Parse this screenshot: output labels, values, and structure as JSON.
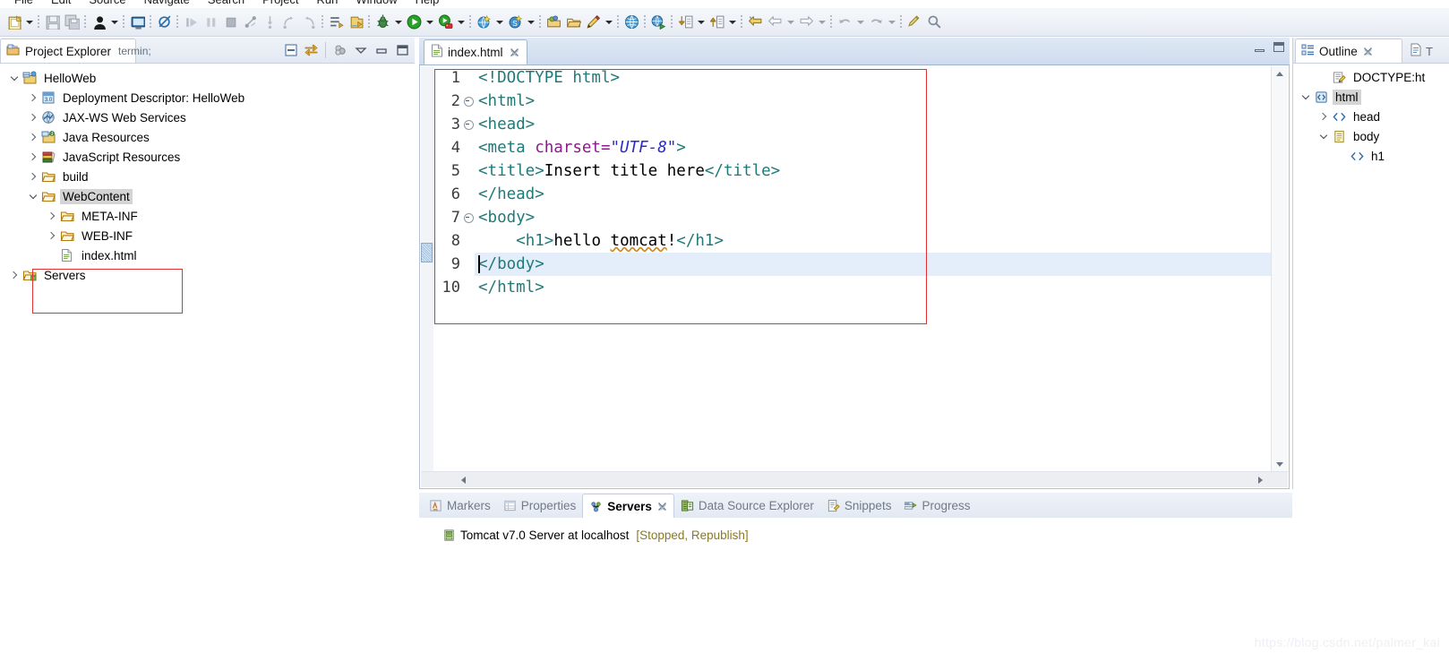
{
  "menubar": {
    "items": [
      "File",
      "Edit",
      "Source",
      "Navigate",
      "Search",
      "Project",
      "Run",
      "Window",
      "Help"
    ]
  },
  "toolbar": {
    "groups": [
      {
        "buttons": [
          {
            "name": "new-wizard-icon",
            "glyph": "new"
          },
          {
            "name": "new-wizard-dropdown-arrow",
            "glyph": "arrow"
          }
        ]
      },
      {
        "buttons": [
          {
            "name": "save-icon",
            "glyph": "save"
          },
          {
            "name": "save-all-icon",
            "glyph": "saveall"
          }
        ]
      },
      {
        "buttons": [
          {
            "name": "user-icon",
            "glyph": "person"
          },
          {
            "name": "user-dropdown-arrow",
            "glyph": "arrow"
          }
        ]
      },
      {
        "buttons": [
          {
            "name": "console-icon",
            "glyph": "console"
          }
        ]
      },
      {
        "buttons": [
          {
            "name": "skip-breakpoints-icon",
            "glyph": "nobreak"
          }
        ]
      },
      {
        "buttons": [
          {
            "name": "resume-icon",
            "glyph": "resume"
          },
          {
            "name": "suspend-icon",
            "glyph": "suspend"
          },
          {
            "name": "terminate-icon",
            "glyph": "terminate"
          },
          {
            "name": "disconnect-icon",
            "glyph": "disconnect"
          },
          {
            "name": "step-into-icon",
            "glyph": "stepinto"
          },
          {
            "name": "step-over-icon",
            "glyph": "stepover"
          },
          {
            "name": "step-return-icon",
            "glyph": "stepreturn"
          }
        ]
      },
      {
        "buttons": [
          {
            "name": "open-type-icon",
            "glyph": "opentype"
          },
          {
            "name": "open-task-icon",
            "glyph": "opentask"
          }
        ]
      },
      {
        "buttons": [
          {
            "name": "debug-icon",
            "glyph": "bug"
          },
          {
            "name": "debug-dropdown-arrow",
            "glyph": "arrow"
          },
          {
            "name": "run-icon",
            "glyph": "play"
          },
          {
            "name": "run-dropdown-arrow",
            "glyph": "arrow"
          },
          {
            "name": "run-on-server-icon",
            "glyph": "runserver"
          },
          {
            "name": "run-on-server-dropdown-arrow",
            "glyph": "arrow"
          }
        ]
      },
      {
        "buttons": [
          {
            "name": "new-web-project-icon",
            "glyph": "webnew"
          },
          {
            "name": "new-web-project-dropdown-arrow",
            "glyph": "arrow"
          },
          {
            "name": "new-server-icon",
            "glyph": "servernew"
          },
          {
            "name": "new-server-dropdown-arrow",
            "glyph": "arrow"
          }
        ]
      },
      {
        "buttons": [
          {
            "name": "open-package-icon",
            "glyph": "pkgopen"
          },
          {
            "name": "open-folder-icon",
            "glyph": "folderopen"
          },
          {
            "name": "edit-icon",
            "glyph": "pencil"
          },
          {
            "name": "edit-dropdown-arrow",
            "glyph": "arrow"
          }
        ]
      },
      {
        "buttons": [
          {
            "name": "open-browser-icon",
            "glyph": "globe"
          }
        ]
      },
      {
        "buttons": [
          {
            "name": "publish-run-icon",
            "glyph": "publishrun"
          }
        ]
      },
      {
        "buttons": [
          {
            "name": "import-icon",
            "glyph": "import"
          },
          {
            "name": "import-dropdown-arrow",
            "glyph": "arrow"
          },
          {
            "name": "export-icon",
            "glyph": "export"
          },
          {
            "name": "export-dropdown-arrow",
            "glyph": "arrow"
          }
        ]
      },
      {
        "buttons": [
          {
            "name": "annotation-next-icon",
            "glyph": "annot"
          },
          {
            "name": "back-icon",
            "glyph": "back"
          },
          {
            "name": "back-dropdown-arrow",
            "glyph": "arrowdim"
          },
          {
            "name": "forward-icon",
            "glyph": "forward"
          },
          {
            "name": "forward-dropdown-arrow",
            "glyph": "arrowdim"
          }
        ]
      },
      {
        "buttons": [
          {
            "name": "undo-icon",
            "glyph": "undo"
          },
          {
            "name": "undo-dropdown-arrow",
            "glyph": "arrowdim"
          },
          {
            "name": "redo-icon",
            "glyph": "redo"
          },
          {
            "name": "redo-dropdown-arrow",
            "glyph": "arrowdim"
          }
        ]
      },
      {
        "buttons": [
          {
            "name": "last-edit-location-icon",
            "glyph": "lastedit"
          },
          {
            "name": "search-icon",
            "glyph": "search"
          }
        ]
      }
    ]
  },
  "project_explorer": {
    "tab_label": "Project Explorer",
    "close_icon": "close-icon",
    "toolbar": [
      {
        "name": "collapse-all-icon"
      },
      {
        "name": "link-with-editor-icon"
      },
      {
        "name": "view-filter-icon"
      },
      {
        "name": "view-menu-icon"
      },
      {
        "name": "minimize-icon"
      },
      {
        "name": "maximize-icon"
      }
    ],
    "tree": [
      {
        "label": "HelloWeb",
        "indent": 0,
        "twist": "expanded",
        "icon": "web-project-icon",
        "selected": false
      },
      {
        "label": "Deployment Descriptor: HelloWeb",
        "indent": 1,
        "twist": "collapsed",
        "icon": "deployment-descriptor-icon",
        "selected": false
      },
      {
        "label": "JAX-WS Web Services",
        "indent": 1,
        "twist": "collapsed",
        "icon": "jaxws-icon",
        "selected": false
      },
      {
        "label": "Java Resources",
        "indent": 1,
        "twist": "collapsed",
        "icon": "java-resources-icon",
        "selected": false
      },
      {
        "label": "JavaScript Resources",
        "indent": 1,
        "twist": "collapsed",
        "icon": "javascript-resources-icon",
        "selected": false
      },
      {
        "label": "build",
        "indent": 1,
        "twist": "collapsed",
        "icon": "folder-icon",
        "selected": false
      },
      {
        "label": "WebContent",
        "indent": 1,
        "twist": "expanded",
        "icon": "folder-icon",
        "selected": true
      },
      {
        "label": "META-INF",
        "indent": 2,
        "twist": "collapsed",
        "icon": "folder-icon",
        "selected": false
      },
      {
        "label": "WEB-INF",
        "indent": 2,
        "twist": "collapsed",
        "icon": "folder-icon",
        "selected": false
      },
      {
        "label": "index.html",
        "indent": 2,
        "twist": "none",
        "icon": "html-file-icon",
        "selected": false
      },
      {
        "label": "Servers",
        "indent": 0,
        "twist": "collapsed",
        "icon": "servers-folder-icon",
        "selected": false
      }
    ]
  },
  "editor": {
    "tab_label": "index.html",
    "tab_icon": "html-file-icon",
    "close_icon": "close-icon",
    "minimize_icon": "minimize-icon",
    "maximize_icon": "maximize-icon",
    "current_line": 9,
    "lines": [
      {
        "num": "1",
        "fold": false,
        "current": false,
        "parts": [
          {
            "t": "tag",
            "s": "<!DOCTYPE html>"
          }
        ]
      },
      {
        "num": "2",
        "fold": true,
        "current": false,
        "parts": [
          {
            "t": "tag",
            "s": "<html>"
          }
        ]
      },
      {
        "num": "3",
        "fold": true,
        "current": false,
        "parts": [
          {
            "t": "tag",
            "s": "<head>"
          }
        ]
      },
      {
        "num": "4",
        "fold": false,
        "current": false,
        "parts": [
          {
            "t": "tag",
            "s": "<meta "
          },
          {
            "t": "attrname",
            "s": "charset="
          },
          {
            "t": "attrval",
            "s": "\"UTF-8\""
          },
          {
            "t": "tag",
            "s": ">"
          }
        ]
      },
      {
        "num": "5",
        "fold": false,
        "current": false,
        "parts": [
          {
            "t": "tag",
            "s": "<title>"
          },
          {
            "t": "txt",
            "s": "Insert title here"
          },
          {
            "t": "tag",
            "s": "</title>"
          }
        ]
      },
      {
        "num": "6",
        "fold": false,
        "current": false,
        "parts": [
          {
            "t": "tag",
            "s": "</head>"
          }
        ]
      },
      {
        "num": "7",
        "fold": true,
        "current": false,
        "parts": [
          {
            "t": "tag",
            "s": "<body>"
          }
        ]
      },
      {
        "num": "8",
        "fold": false,
        "current": false,
        "parts": [
          {
            "t": "txt",
            "s": "    "
          },
          {
            "t": "tag",
            "s": "<h1>"
          },
          {
            "t": "txt",
            "s": "hello "
          },
          {
            "t": "misspelled",
            "s": "tomcat"
          },
          {
            "t": "txt",
            "s": "!"
          },
          {
            "t": "tag",
            "s": "</h1>"
          }
        ]
      },
      {
        "num": "9",
        "fold": false,
        "current": true,
        "parts": [
          {
            "t": "tag",
            "s": "</body>"
          }
        ]
      },
      {
        "num": "10",
        "fold": false,
        "current": false,
        "parts": [
          {
            "t": "tag",
            "s": "</html>"
          }
        ]
      }
    ]
  },
  "bottom_panel": {
    "tabs": [
      {
        "label": "Markers",
        "icon": "markers-icon",
        "active": false,
        "close": false
      },
      {
        "label": "Properties",
        "icon": "properties-icon",
        "active": false,
        "close": false
      },
      {
        "label": "Servers",
        "icon": "servers-icon",
        "active": true,
        "close": true
      },
      {
        "label": "Data Source Explorer",
        "icon": "datasource-icon",
        "active": false,
        "close": false
      },
      {
        "label": "Snippets",
        "icon": "snippets-icon",
        "active": false,
        "close": false
      },
      {
        "label": "Progress",
        "icon": "progress-icon",
        "active": false,
        "close": false
      }
    ],
    "servers": [
      {
        "icon": "server-icon",
        "name": "Tomcat v7.0 Server at localhost",
        "state": "[Stopped, Republish]"
      }
    ]
  },
  "outline": {
    "tab_label": "Outline",
    "close_icon": "close-icon",
    "secondary_tab_label": "T",
    "tree": [
      {
        "label": "DOCTYPE:ht",
        "indent": 1,
        "twist": "none",
        "icon": "doctype-icon",
        "selected": false
      },
      {
        "label": "html",
        "indent": 0,
        "twist": "expanded",
        "icon": "element-icon",
        "selected": true
      },
      {
        "label": "head",
        "indent": 1,
        "twist": "collapsed",
        "icon": "tagpair-icon",
        "selected": false
      },
      {
        "label": "body",
        "indent": 1,
        "twist": "expanded",
        "icon": "body-icon",
        "selected": false
      },
      {
        "label": "h1",
        "indent": 2,
        "twist": "none",
        "icon": "tagpair-icon",
        "selected": false
      }
    ]
  },
  "annotations": {
    "tree_highlight_color": "#e03030",
    "code_highlight_color": "#e03030"
  },
  "watermark": {
    "text": "https://blog.csdn.net/palmer_kai"
  }
}
